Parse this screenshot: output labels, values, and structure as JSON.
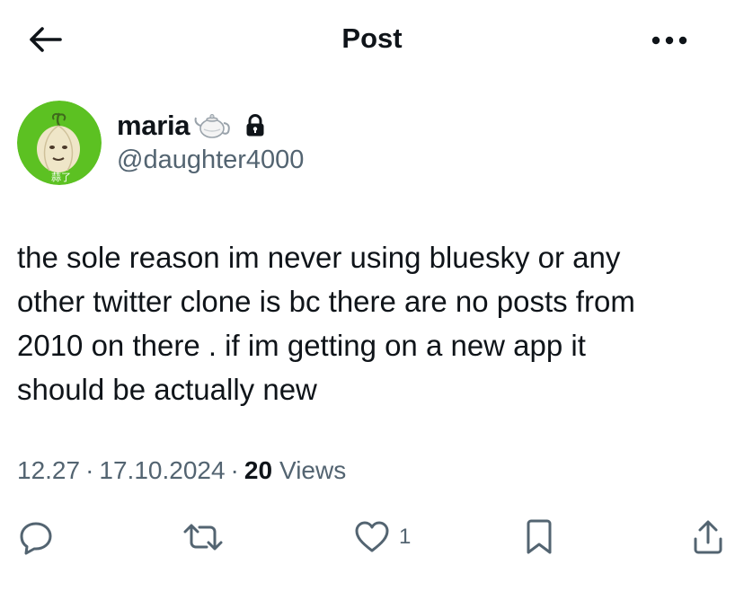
{
  "header": {
    "back_icon": "arrow-left-icon",
    "title": "Post",
    "more_icon": "more-horizontal-icon"
  },
  "author": {
    "display_name": "maria",
    "name_emoji": "teapot-icon",
    "protected_icon": "lock-icon",
    "handle": "@daughter4000",
    "avatar": "green-garlic-avatar"
  },
  "tweet": {
    "text": "the sole reason im never using bluesky or any\nother twitter clone is bc there are no posts from\n2010 on there . if im getting on a new app it\nshould be actually new"
  },
  "meta": {
    "time": "12.27",
    "separator": "·",
    "date": "17.10.2024",
    "views_count": "20",
    "views_label": "Views"
  },
  "actions": {
    "reply_icon": "reply-icon",
    "retweet_icon": "retweet-icon",
    "like_icon": "heart-icon",
    "like_count": "1",
    "bookmark_icon": "bookmark-icon",
    "share_icon": "share-icon"
  },
  "colors": {
    "text": "#0f1419",
    "secondary": "#536471",
    "avatar_bg": "#5cc122"
  }
}
